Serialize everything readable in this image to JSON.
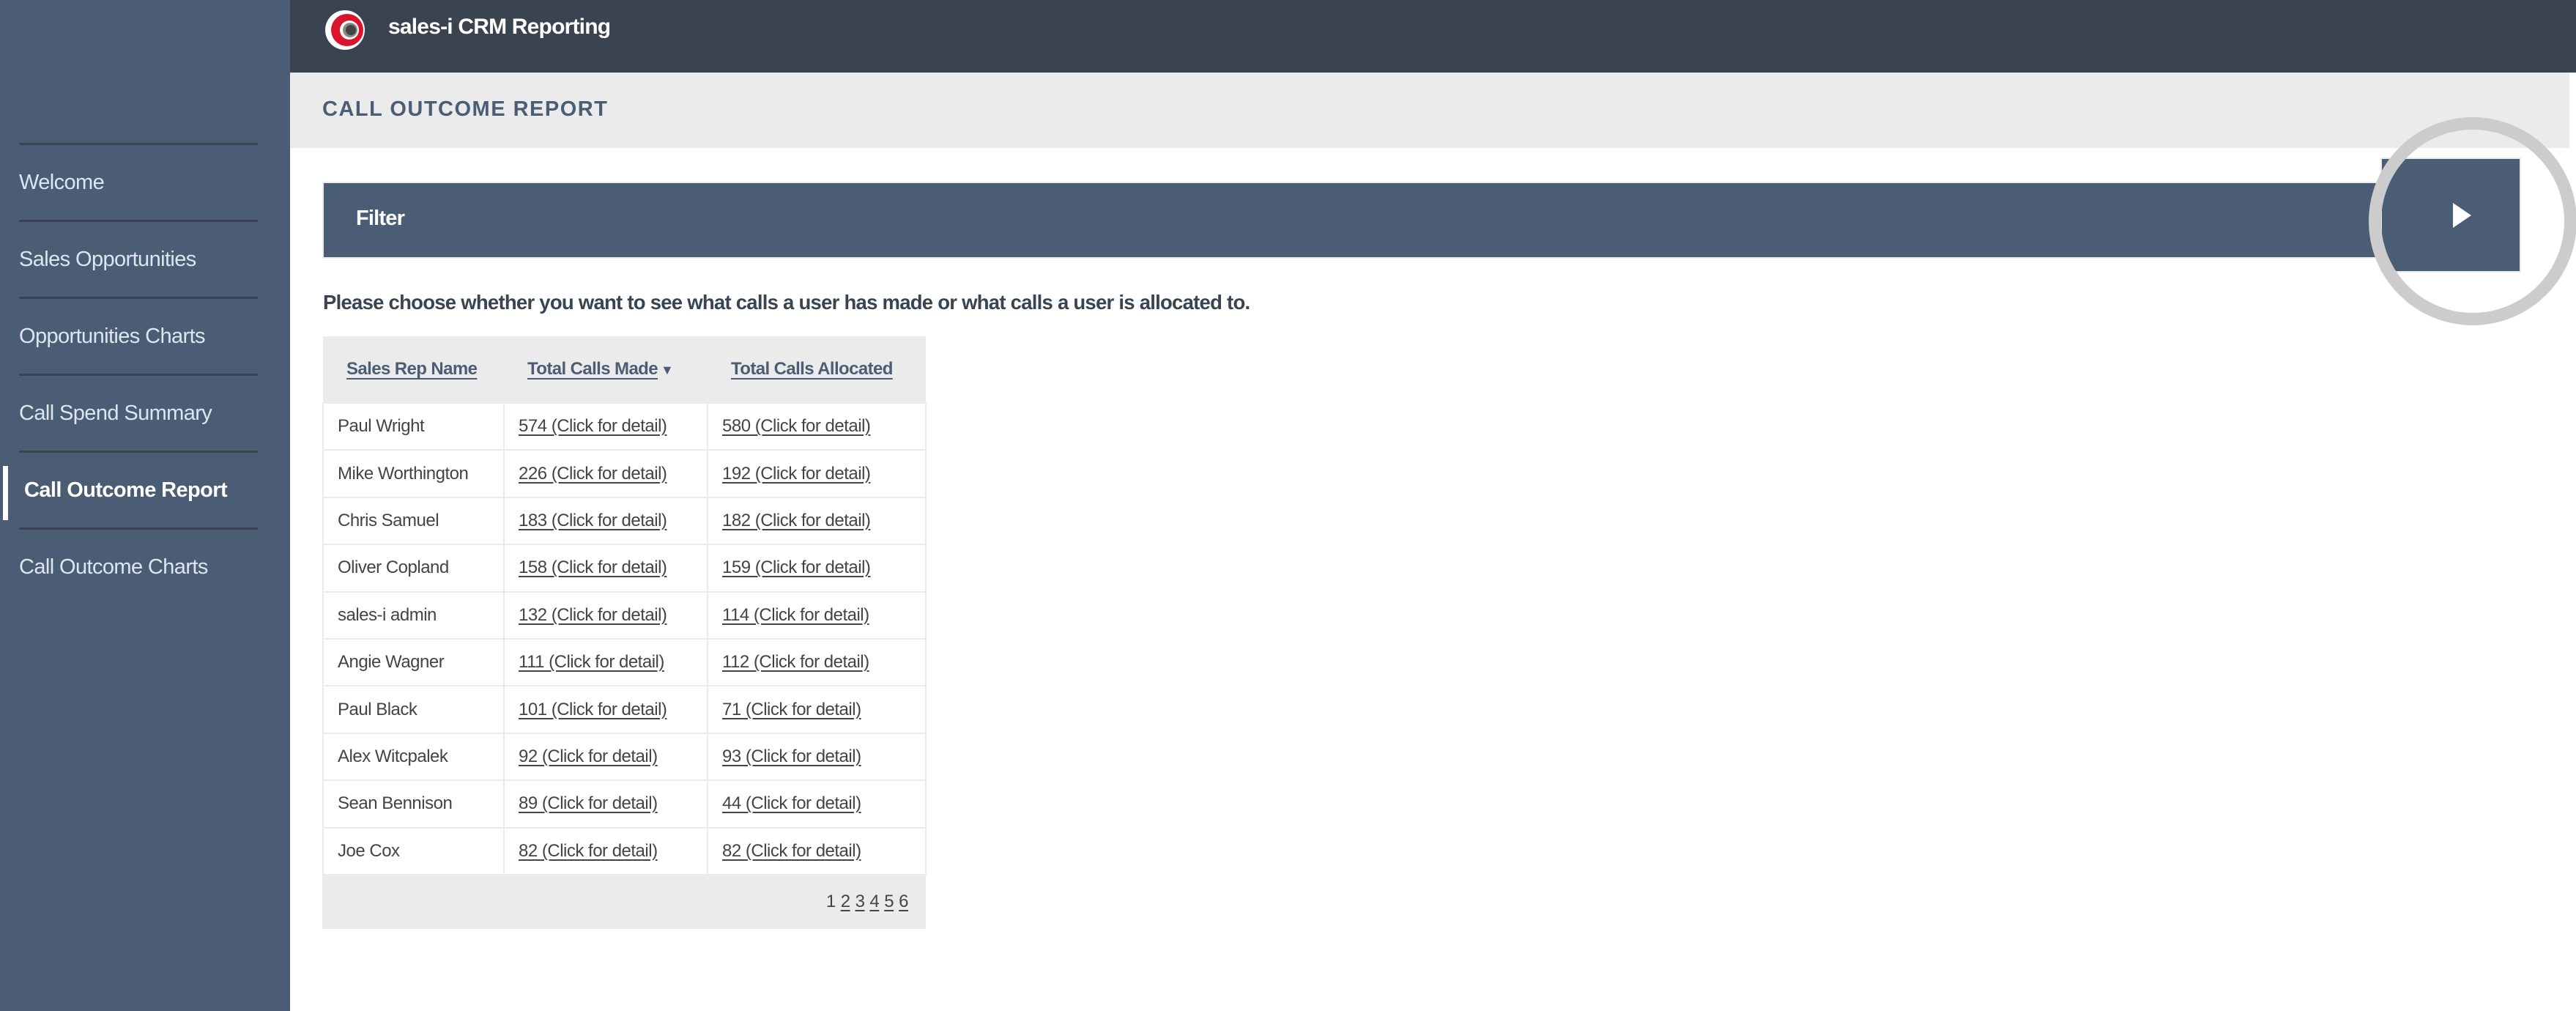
{
  "app": {
    "title": "sales-i CRM Reporting",
    "logo_icon": "sales-i-logo-icon"
  },
  "page": {
    "title": "CALL OUTCOME REPORT"
  },
  "sidebar": {
    "items": [
      {
        "label": "Welcome",
        "active": false
      },
      {
        "label": "Sales Opportunities",
        "active": false
      },
      {
        "label": "Opportunities Charts",
        "active": false
      },
      {
        "label": "Call Spend Summary",
        "active": false
      },
      {
        "label": "Call Outcome Report",
        "active": true
      },
      {
        "label": "Call Outcome Charts",
        "active": false
      }
    ]
  },
  "filter": {
    "label": "Filter",
    "toggle_icon": "play-icon"
  },
  "prompt": "Please choose whether you want to see what calls a user has made or what calls a user is allocated to.",
  "table": {
    "headers": {
      "name": "Sales Rep Name",
      "made": "Total Calls Made",
      "allocated": "Total Calls Allocated",
      "sort_indicator": "▼"
    },
    "rows": [
      {
        "name": "Paul Wright",
        "made": "574 (Click for detail)",
        "allocated": "580 (Click for detail)"
      },
      {
        "name": "Mike Worthington",
        "made": "226 (Click for detail)",
        "allocated": "192 (Click for detail)"
      },
      {
        "name": "Chris Samuel",
        "made": "183 (Click for detail)",
        "allocated": "182 (Click for detail)"
      },
      {
        "name": "Oliver Copland",
        "made": "158 (Click for detail)",
        "allocated": "159 (Click for detail)"
      },
      {
        "name": "sales-i admin",
        "made": "132 (Click for detail)",
        "allocated": "114 (Click for detail)"
      },
      {
        "name": "Angie Wagner",
        "made": "111 (Click for detail)",
        "allocated": "112 (Click for detail)"
      },
      {
        "name": "Paul Black",
        "made": "101 (Click for detail)",
        "allocated": "71 (Click for detail)"
      },
      {
        "name": "Alex Witcpalek",
        "made": "92 (Click for detail)",
        "allocated": "93 (Click for detail)"
      },
      {
        "name": "Sean Bennison",
        "made": "89 (Click for detail)",
        "allocated": "44 (Click for detail)"
      },
      {
        "name": "Joe Cox",
        "made": "82 (Click for detail)",
        "allocated": "82 (Click for detail)"
      }
    ],
    "pagination": {
      "current": "1",
      "pages": [
        "2",
        "3",
        "4",
        "5",
        "6"
      ]
    }
  },
  "colors": {
    "sidebar": "#4a5d75",
    "header": "#3a4451",
    "subheader": "#ebebeb",
    "accent_red": "#d9142b",
    "highlight_ring": "#cccccc"
  }
}
